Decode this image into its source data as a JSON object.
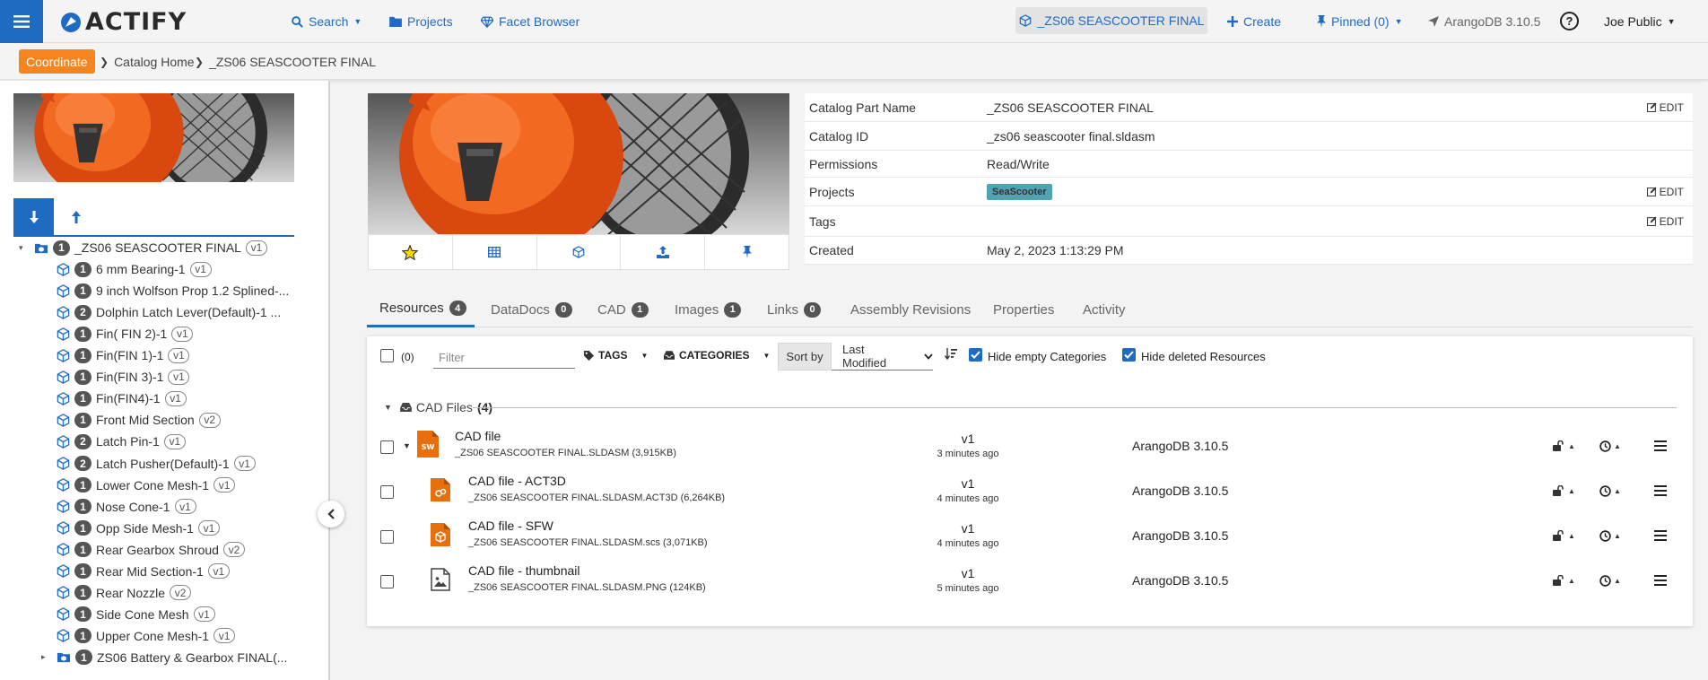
{
  "app": {
    "logo_text": "ACTIFY"
  },
  "nav": {
    "search": "Search",
    "projects": "Projects",
    "facet_browser": "Facet Browser",
    "pinned_project": "_ZS06 SEASCOOTER FINAL",
    "create": "Create",
    "pinned": "Pinned (0)",
    "db_version": "ArangoDB 3.10.5",
    "help": "?",
    "user": "Joe Public"
  },
  "breadcrumb": {
    "badge": "Coordinate",
    "home": "Catalog Home",
    "current": "_ZS06 SEASCOOTER FINAL"
  },
  "tree": [
    {
      "level": 0,
      "tog": "▾",
      "label": "_ZS06 SEASCOOTER FINAL",
      "count": "1",
      "ver": "v1",
      "folder": true
    },
    {
      "level": 1,
      "label": "6 mm Bearing-1",
      "count": "1",
      "ver": "v1"
    },
    {
      "level": 1,
      "label": "9 inch Wolfson Prop 1.2 Splined-...",
      "count": "1",
      "ver": ""
    },
    {
      "level": 1,
      "label": "Dolphin Latch Lever(Default)-1 ...",
      "count": "2",
      "ver": ""
    },
    {
      "level": 1,
      "label": "Fin( FIN 2)-1",
      "count": "1",
      "ver": "v1"
    },
    {
      "level": 1,
      "label": "Fin(FIN 1)-1",
      "count": "1",
      "ver": "v1"
    },
    {
      "level": 1,
      "label": "Fin(FIN 3)-1",
      "count": "1",
      "ver": "v1"
    },
    {
      "level": 1,
      "label": "Fin(FIN4)-1",
      "count": "1",
      "ver": "v1"
    },
    {
      "level": 1,
      "label": "Front Mid Section",
      "count": "1",
      "ver": "v2"
    },
    {
      "level": 1,
      "label": "Latch Pin-1",
      "count": "2",
      "ver": "v1"
    },
    {
      "level": 1,
      "label": "Latch Pusher(Default)-1",
      "count": "2",
      "ver": "v1"
    },
    {
      "level": 1,
      "label": "Lower Cone Mesh-1",
      "count": "1",
      "ver": "v1"
    },
    {
      "level": 1,
      "label": "Nose Cone-1",
      "count": "1",
      "ver": "v1"
    },
    {
      "level": 1,
      "label": "Opp Side Mesh-1",
      "count": "1",
      "ver": "v1"
    },
    {
      "level": 1,
      "label": "Rear Gearbox Shroud",
      "count": "1",
      "ver": "v2"
    },
    {
      "level": 1,
      "label": "Rear Mid Section-1",
      "count": "1",
      "ver": "v1"
    },
    {
      "level": 1,
      "label": "Rear Nozzle",
      "count": "1",
      "ver": "v2"
    },
    {
      "level": 1,
      "label": "Side Cone Mesh",
      "count": "1",
      "ver": "v1"
    },
    {
      "level": 1,
      "label": "Upper Cone Mesh-1",
      "count": "1",
      "ver": "v1"
    },
    {
      "level": 1,
      "tog": "▸",
      "label": "ZS06 Battery & Gearbox FINAL(...",
      "count": "1",
      "ver": "",
      "folder": true
    }
  ],
  "properties": {
    "part_name_label": "Catalog Part Name",
    "part_name": "_ZS06 SEASCOOTER FINAL",
    "catalog_id_label": "Catalog ID",
    "catalog_id": "_zs06 seascooter final.sldasm",
    "permissions_label": "Permissions",
    "permissions": "Read/Write",
    "projects_label": "Projects",
    "project_tag": "SeaScooter",
    "tags_label": "Tags",
    "created_label": "Created",
    "created": "May 2, 2023 1:13:29 PM",
    "edit": "EDIT"
  },
  "tabs": [
    {
      "label": "Resources",
      "count": "4"
    },
    {
      "label": "DataDocs",
      "count": "0"
    },
    {
      "label": "CAD",
      "count": "1"
    },
    {
      "label": "Images",
      "count": "1"
    },
    {
      "label": "Links",
      "count": "0"
    },
    {
      "label": "Assembly Revisions",
      "count": ""
    },
    {
      "label": "Properties",
      "count": ""
    },
    {
      "label": "Activity",
      "count": ""
    }
  ],
  "toolbar": {
    "selected_count": "(0)",
    "filter_placeholder": "Filter",
    "tags": "TAGS",
    "categories": "CATEGORIES",
    "sort_by": "Sort by",
    "sort_value": "Last Modified",
    "hide_empty": "Hide empty Categories",
    "hide_deleted": "Hide deleted Resources"
  },
  "group": {
    "label": "CAD Files",
    "count": "(4)"
  },
  "resources": [
    {
      "name": "CAD file",
      "file": "_ZS06 SEASCOOTER FINAL.SLDASM (3,915KB)",
      "ver": "v1",
      "time": "3 minutes ago",
      "db": "ArangoDB 3.10.5",
      "icon": "sw"
    },
    {
      "name": "CAD file - ACT3D",
      "file": "_ZS06 SEASCOOTER FINAL.SLDASM.ACT3D (6,264KB)",
      "ver": "v1",
      "time": "4 minutes ago",
      "db": "ArangoDB 3.10.5",
      "icon": "act"
    },
    {
      "name": "CAD file - SFW",
      "file": "_ZS06 SEASCOOTER FINAL.SLDASM.scs (3,071KB)",
      "ver": "v1",
      "time": "4 minutes ago",
      "db": "ArangoDB 3.10.5",
      "icon": "cube"
    },
    {
      "name": "CAD file - thumbnail",
      "file": "_ZS06 SEASCOOTER FINAL.SLDASM.PNG (124KB)",
      "ver": "v1",
      "time": "5 minutes ago",
      "db": "ArangoDB 3.10.5",
      "icon": "img"
    }
  ]
}
